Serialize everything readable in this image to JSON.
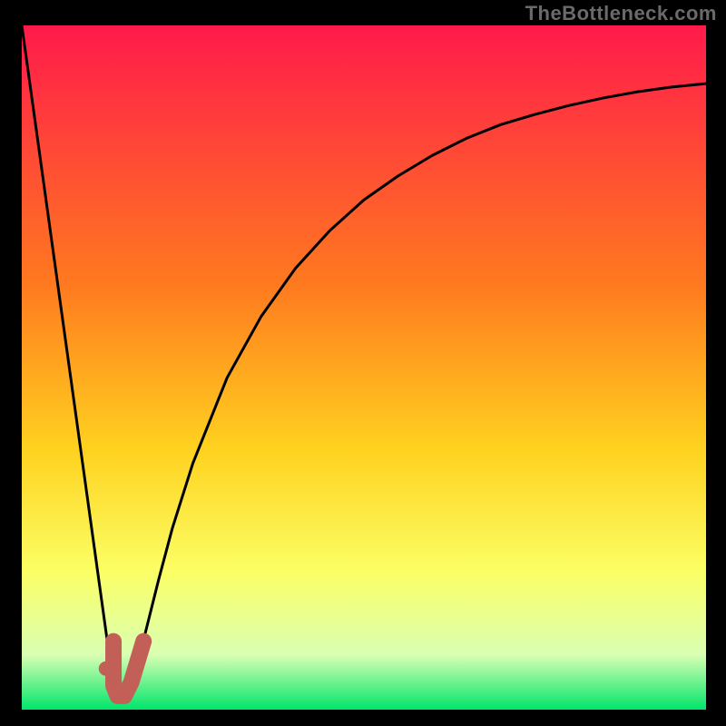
{
  "watermark": "TheBottleneck.com",
  "colors": {
    "frame": "#000000",
    "watermark": "#6a6a6a",
    "gradient_top": "#ff1a4b",
    "gradient_mid1": "#ff7a1f",
    "gradient_mid2": "#ffd21f",
    "gradient_mid3": "#fbff66",
    "gradient_mid4": "#d9ffb3",
    "gradient_bottom": "#00e56b",
    "curve": "#000000",
    "marker_fill": "#c26057",
    "marker_stroke": "#c26057"
  },
  "chart_data": {
    "type": "line",
    "title": "",
    "xlabel": "",
    "ylabel": "",
    "xlim": [
      0,
      100
    ],
    "ylim": [
      0,
      100
    ],
    "series": [
      {
        "name": "bottleneck-curve",
        "x": [
          0,
          2,
          4,
          6,
          8,
          10,
          12,
          13.4,
          14,
          15,
          16,
          18,
          20,
          22,
          25,
          30,
          35,
          40,
          45,
          50,
          55,
          60,
          65,
          70,
          75,
          80,
          85,
          90,
          95,
          100
        ],
        "y": [
          100,
          85.6,
          71.2,
          56.8,
          42.4,
          28.0,
          13.6,
          3.5,
          2.0,
          2.0,
          4.0,
          11.0,
          19.0,
          26.5,
          36.0,
          48.5,
          57.5,
          64.5,
          70.0,
          74.5,
          78.0,
          81.0,
          83.5,
          85.5,
          87.0,
          88.3,
          89.4,
          90.3,
          91.0,
          91.5
        ]
      }
    ],
    "markers": {
      "dot": {
        "x": 12.3,
        "y": 6.0
      },
      "j_path": [
        {
          "x": 13.4,
          "y": 10.0
        },
        {
          "x": 13.4,
          "y": 3.5
        },
        {
          "x": 14.0,
          "y": 2.0
        },
        {
          "x": 15.0,
          "y": 2.0
        },
        {
          "x": 16.0,
          "y": 4.0
        },
        {
          "x": 17.8,
          "y": 10.0
        }
      ]
    }
  }
}
